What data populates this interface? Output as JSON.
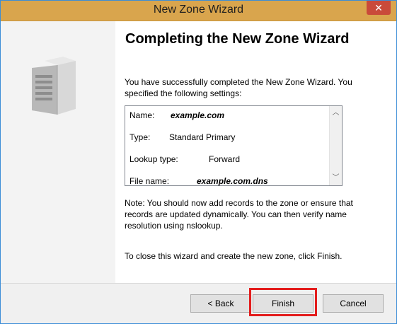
{
  "window": {
    "title": "New Zone Wizard",
    "close_glyph": "✕"
  },
  "main": {
    "heading": "Completing the New Zone Wizard",
    "intro": "You have successfully completed the New Zone Wizard. You specified the following settings:",
    "settings": [
      {
        "label": "Name:",
        "value": "example.com"
      },
      {
        "label": "Type:",
        "value": "Standard Primary"
      },
      {
        "label": "Lookup type:",
        "value": "Forward"
      },
      {
        "label": "File name:",
        "value": "example.com.dns"
      }
    ],
    "note": "Note: You should now add records to the zone or ensure that records are updated dynamically. You can then verify name resolution using nslookup.",
    "close_instruction": "To close this wizard and create the new zone, click Finish."
  },
  "buttons": {
    "back": "< Back",
    "finish": "Finish",
    "cancel": "Cancel"
  },
  "colors": {
    "titlebar": "#d9a54d",
    "highlight": "#e31d1d"
  }
}
